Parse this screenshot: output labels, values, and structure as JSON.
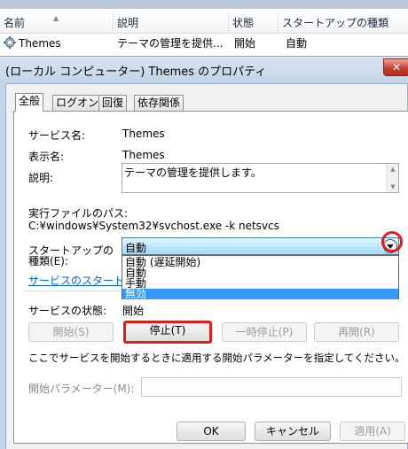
{
  "list": {
    "columns": [
      "名前",
      "説明",
      "状態",
      "スタートアップの種類"
    ],
    "row": {
      "name": "Themes",
      "description": "テーマの管理を提供...",
      "status": "開始",
      "startup": "自動"
    }
  },
  "dialog": {
    "title": "(ローカル コンピューター) Themes のプロパティ",
    "close_glyph": "✕",
    "tabs": [
      "全般",
      "ログオン",
      "回復",
      "依存関係"
    ],
    "service_name_label": "サービス名:",
    "service_name": "Themes",
    "display_name_label": "表示名:",
    "display_name": "Themes",
    "description_label": "説明:",
    "description": "テーマの管理を提供します。",
    "exe_path_label": "実行ファイルのパス:",
    "exe_path": "C:¥windows¥System32¥svchost.exe -k netsvcs",
    "startup_label_1": "スタートアップの",
    "startup_label_2": "種類(E):",
    "startup_selected": "自動",
    "startup_options": [
      "自動 (遅延開始)",
      "自動",
      "手動",
      "無効"
    ],
    "startup_help_link": "サービスのスタートアップ",
    "status_label": "サービスの状態:",
    "status_value": "開始",
    "buttons": {
      "start": "開始(S)",
      "stop": "停止(T)",
      "pause": "一時停止(P)",
      "resume": "再開(R)"
    },
    "hint": "ここでサービスを開始するときに適用する開始パラメーターを指定してください。",
    "start_params_label": "開始パラメーター(M):",
    "ok": "OK",
    "cancel": "キャンセル",
    "apply": "適用(A)"
  }
}
